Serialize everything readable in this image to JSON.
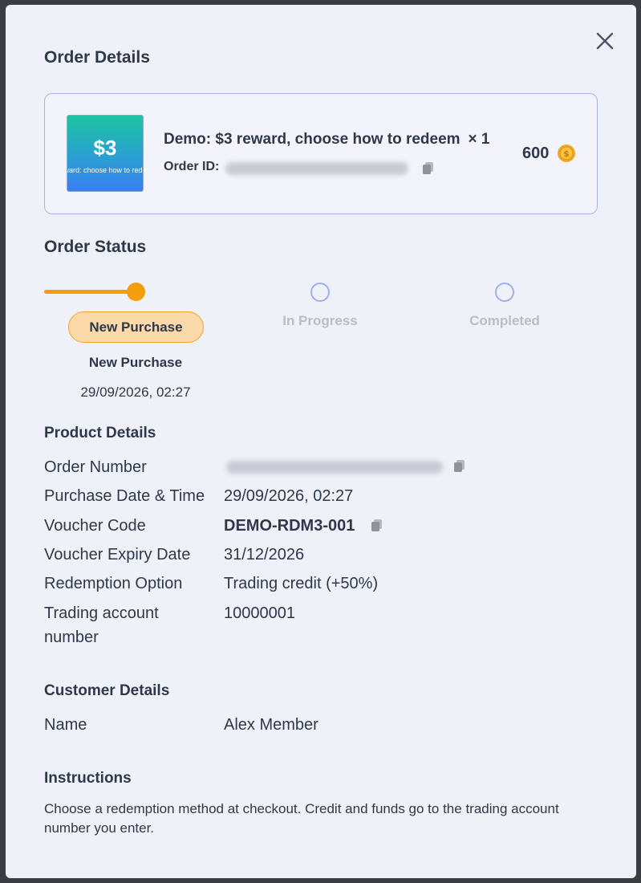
{
  "dialog": {
    "title": "Order Details",
    "close_icon": "close-icon"
  },
  "product": {
    "thumb_price": "$3",
    "thumb_caption": "ward: choose how to rede",
    "name": "Demo: $3 reward, choose how to redeem",
    "quantity": "× 1",
    "order_id_label": "Order ID:",
    "price": "600",
    "coin_icon": "coin-icon",
    "copy_icon": "copy-icon"
  },
  "order_status": {
    "title": "Order Status",
    "steps": [
      {
        "label": "New Purchase",
        "active": true
      },
      {
        "label": "In Progress",
        "active": false
      },
      {
        "label": "Completed",
        "active": false
      }
    ],
    "current_label": "New Purchase",
    "current_timestamp": "29/09/2026, 02:27"
  },
  "product_details": {
    "title": "Product Details",
    "rows": [
      {
        "label": "Order Number",
        "value": ""
      },
      {
        "label": "Purchase Date & Time",
        "value": "29/09/2026, 02:27"
      },
      {
        "label": "Voucher Code",
        "value": "DEMO-RDM3-001"
      },
      {
        "label": "Voucher Expiry Date",
        "value": "31/12/2026"
      },
      {
        "label": "Redemption Option",
        "value": "Trading credit (+50%)"
      },
      {
        "label": "Trading account number",
        "value": "10000001"
      }
    ]
  },
  "customer_details": {
    "title": "Customer Details",
    "name_label": "Name",
    "name_value": "Alex Member"
  },
  "instructions": {
    "title": "Instructions",
    "text": "Choose a redemption method at checkout. Credit and funds go to the trading account number you enter."
  },
  "colors": {
    "accent": "#f59e0b",
    "pill_bg": "#fbd9a8",
    "inactive_circle": "#a3aee8",
    "text": "#2f3848",
    "muted": "#b9bdc7"
  }
}
